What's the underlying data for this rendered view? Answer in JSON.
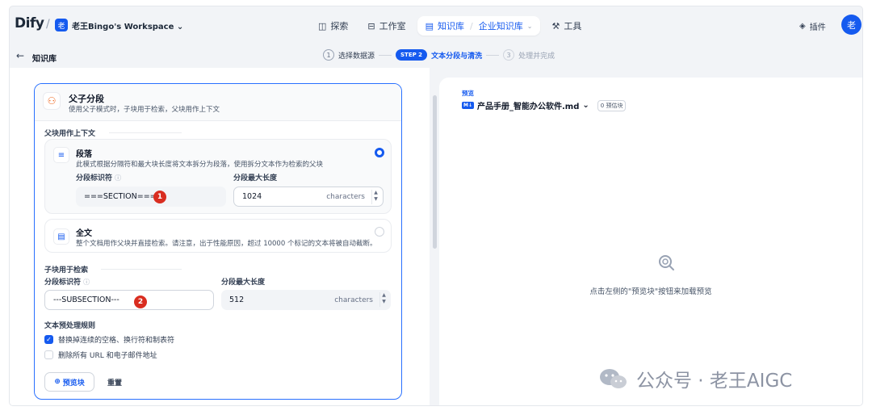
{
  "nav": {
    "logo": "Dify",
    "workspace_badge": "老",
    "workspace_name": "老王Bingo's Workspace",
    "explore": "探索",
    "studio": "工作室",
    "knowledge": "知识库",
    "knowledge_sub": "企业知识库",
    "tools": "工具",
    "plugins": "插件",
    "avatar": "老"
  },
  "subheader": {
    "back_label": "知识库",
    "step1_num": "1",
    "step1_label": "选择数据源",
    "step2_pill": "STEP 2",
    "step2_label": "文本分段与清洗",
    "step3_num": "3",
    "step3_label": "处理并完成"
  },
  "card": {
    "title": "父子分段",
    "desc": "使用父子模式时，子块用于检索，父块用作上下文",
    "parent_section_title": "父块用作上下文",
    "paragraph": {
      "title": "段落",
      "desc": "此模式根据分隔符和最大块长度将文本拆分为段落，使用拆分文本作为检索的父块",
      "separator_label": "分段标识符",
      "separator_value": "===SECTION===",
      "max_len_label": "分段最大长度",
      "max_len_value": "1024",
      "unit": "characters",
      "marker": "1"
    },
    "fulltext": {
      "title": "全文",
      "desc": "整个文档用作父块并直接检索。请注意，出于性能原因，超过 10000 个标记的文本将被自动截断。"
    },
    "child_section_title": "子块用于检索",
    "child": {
      "separator_label": "分段标识符",
      "separator_value": "---SUBSECTION---",
      "max_len_label": "分段最大长度",
      "max_len_value": "512",
      "unit": "characters",
      "marker": "2"
    },
    "preprocess_title": "文本预处理规则",
    "rule1": "替换掉连续的空格、换行符和制表符",
    "rule2": "删除所有 URL 和电子邮件地址",
    "preview_btn": "预览块",
    "reset_btn": "重置"
  },
  "preview": {
    "label": "预览",
    "md_badge": "M↓",
    "filename": "产品手册_智能办公软件.md",
    "estimate": "0 预估块",
    "empty_text": "点击左侧的\"预览块\"按钮来加载预览"
  },
  "watermark": "公众号 · 老王AIGC",
  "colors": {
    "accent": "#155aef",
    "marker": "#d92d20"
  }
}
